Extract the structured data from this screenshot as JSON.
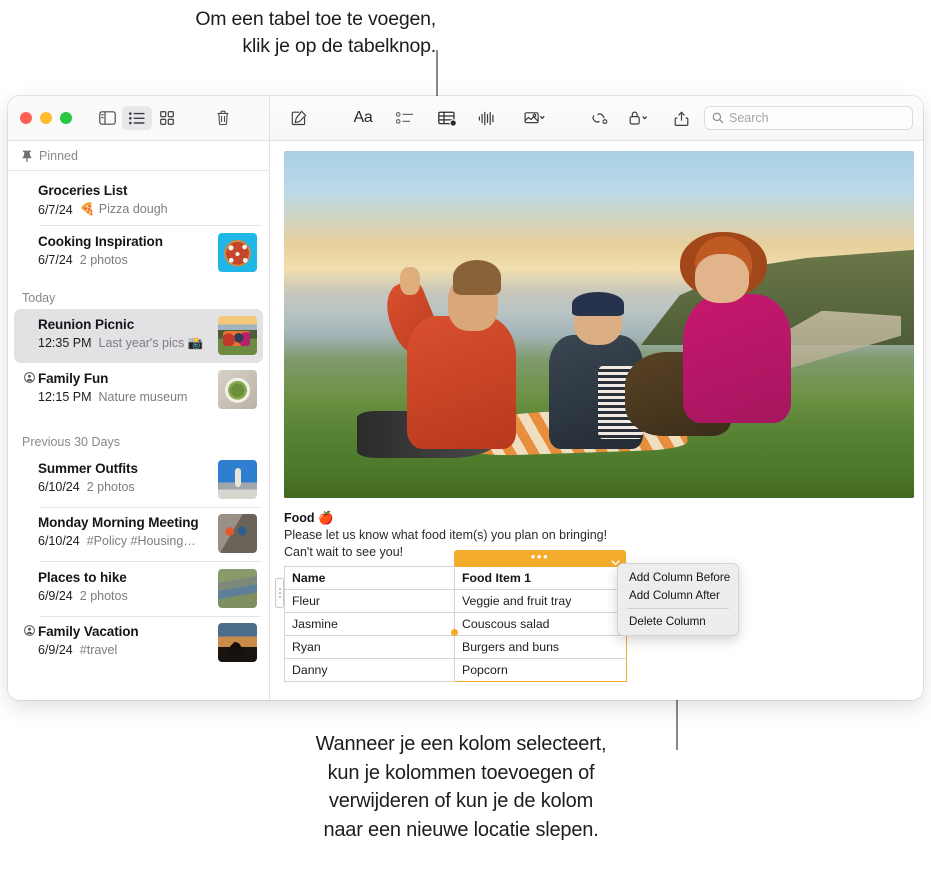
{
  "callouts": {
    "top": "Om een tabel toe te voegen,\nklik je op de tabelknop.",
    "bottom": "Wanneer je een kolom selecteert,\nkun je kolommen toevoegen of\nverwijderen of kun je de kolom\nnaar een nieuwe locatie slepen."
  },
  "toolbar": {
    "window_controls": [
      "close",
      "minimize",
      "zoom"
    ],
    "left_buttons": [
      {
        "name": "sidebar-toggle",
        "icon": "sidebar-icon",
        "active": false
      },
      {
        "name": "list-view",
        "icon": "list-view-icon",
        "active": true
      },
      {
        "name": "gallery-view",
        "icon": "gallery-view-icon",
        "active": false
      },
      {
        "name": "delete-note",
        "icon": "trash-icon",
        "active": false
      }
    ],
    "right_buttons": [
      {
        "name": "new-note",
        "icon": "compose-icon"
      },
      {
        "name": "format",
        "icon": "format-aa-icon",
        "label": "Aa"
      },
      {
        "name": "checklist",
        "icon": "checklist-icon"
      },
      {
        "name": "table",
        "icon": "table-icon"
      },
      {
        "name": "audio",
        "icon": "audio-waveform-icon"
      },
      {
        "name": "media",
        "icon": "media-photo-icon"
      },
      {
        "name": "collaborate",
        "icon": "collaborate-link-icon"
      },
      {
        "name": "lock",
        "icon": "lock-icon"
      },
      {
        "name": "share",
        "icon": "share-icon"
      }
    ],
    "search": {
      "placeholder": "Search",
      "value": "",
      "icon": "search-icon"
    }
  },
  "sidebar": {
    "sections": [
      {
        "title": "Pinned",
        "icon": "pin-icon",
        "notes": [
          {
            "title": "Groceries List",
            "date": "6/7/24",
            "preview": "🍕 Pizza dough",
            "thumb": "",
            "locked": false
          },
          {
            "title": "Cooking Inspiration",
            "date": "6/7/24",
            "preview": "2 photos",
            "thumb": "th-pizza",
            "locked": false
          }
        ]
      },
      {
        "title": "Today",
        "icon": "",
        "notes": [
          {
            "title": "Reunion Picnic",
            "date": "12:35 PM",
            "preview": "Last year's pics 📸",
            "thumb": "th-picnic",
            "locked": false,
            "selected": true
          },
          {
            "title": "Family Fun",
            "date": "12:15 PM",
            "preview": "Nature museum",
            "thumb": "th-salad",
            "locked": true
          }
        ]
      },
      {
        "title": "Previous 30 Days",
        "icon": "",
        "notes": [
          {
            "title": "Summer Outfits",
            "date": "6/10/24",
            "preview": "2 photos",
            "thumb": "th-outfit",
            "locked": false
          },
          {
            "title": "Monday Morning Meeting",
            "date": "6/10/24",
            "preview": "#Policy #Housing…",
            "thumb": "th-climb",
            "locked": false
          },
          {
            "title": "Places to hike",
            "date": "6/9/24",
            "preview": "2 photos",
            "thumb": "th-river",
            "locked": false
          },
          {
            "title": "Family Vacation",
            "date": "6/9/24",
            "preview": "#travel",
            "thumb": "th-bike",
            "locked": true
          }
        ]
      }
    ]
  },
  "editor": {
    "photo_alt": "Three friends sitting on a blanket on a grassy coastal hillside at sunset",
    "heading": "Food 🍎",
    "paragraph_line1": "Please let us know what food item(s) you plan on bringing!",
    "paragraph_line2": "Can't wait to see you!",
    "table": {
      "selected_column_index": 1,
      "column_selector_dots": "•••",
      "headers": [
        "Name",
        "Food Item 1"
      ],
      "rows": [
        [
          "Fleur",
          "Veggie and fruit tray"
        ],
        [
          "Jasmine",
          "Couscous salad"
        ],
        [
          "Ryan",
          "Burgers and buns"
        ],
        [
          "Danny",
          "Popcorn"
        ]
      ]
    }
  },
  "context_menu": {
    "items": [
      "Add Column Before",
      "Add Column After",
      "Delete Column"
    ]
  },
  "colors": {
    "selection_orange": "#f5ab2b",
    "traffic_red": "#ff5f57",
    "traffic_yellow": "#febc2e",
    "traffic_green": "#28c840",
    "sidebar_selection": "#e2e2e4"
  }
}
